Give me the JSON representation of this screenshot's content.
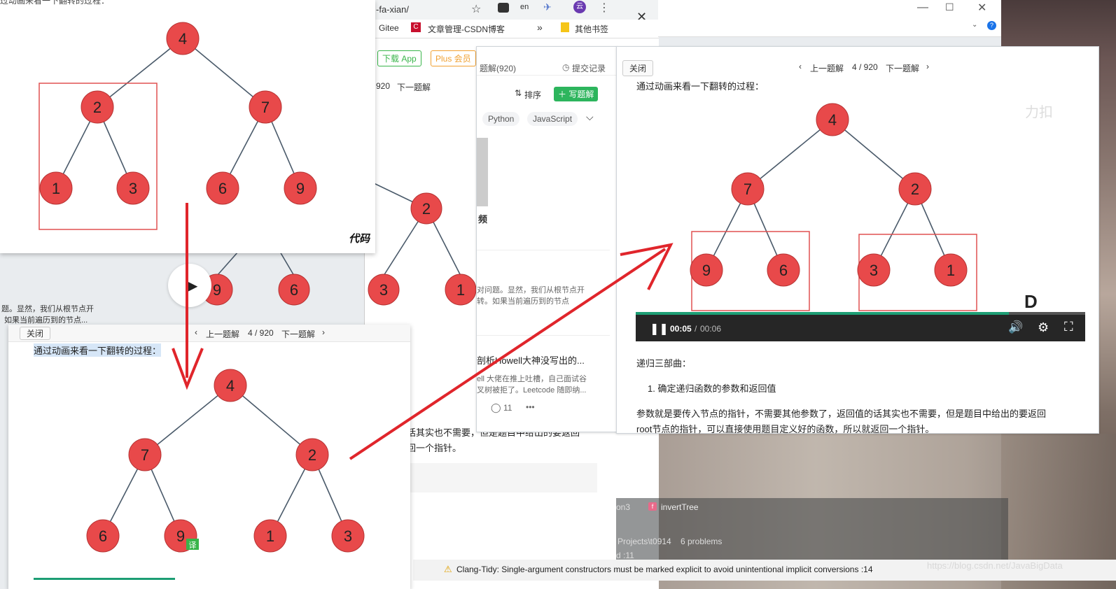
{
  "browser": {
    "url_fragment": "-fa-xian/",
    "bookmarks": [
      "Gitee",
      "文章管理-CSDN博客",
      "其他书签"
    ],
    "download_app": "下载 App",
    "plus_member": "Plus 会员",
    "page_fragment": "920",
    "next_solution": "下一题解",
    "bg_text_1": "题。显然，我们从根节点开",
    "bg_text_2": "如果当前遍历到的节点...",
    "bg_text_3": "话其实也不需要，但是题目中给出的要返回",
    "bg_text_4": "回一个指针。"
  },
  "list_panel": {
    "tab_solutions": "题解(920)",
    "tab_submissions": "提交记录",
    "sort": "排序",
    "write_solution": "写题解",
    "lang_tags": [
      "Python",
      "JavaScript"
    ],
    "video_label": "频",
    "item_text_1": "对问题。显然，我们从根节点开",
    "item_text_2": "转。如果当前遍历到的节点",
    "item_title": "剖析Howell大神没写出的...",
    "item_desc_1": "ell 大佬在推上吐槽，自己面试谷",
    "item_desc_2": "叉树被拒了。Leetcode 随即纳...",
    "comments": "11",
    "more": "•••"
  },
  "main_panel": {
    "close": "关闭",
    "prev": "上一题解",
    "page": "4 / 920",
    "next": "下一题解",
    "caption": "通过动画来看一下翻转的过程：",
    "watermark": "力扣",
    "time_current": "00:05",
    "time_total": "00:06",
    "progress": 0.83,
    "section_title": "递归三部曲：",
    "step_1": "1. 确定递归函数的参数和返回值",
    "para_1": "参数就是要传入节点的指针，不需要其他参数了，返回值的话其实也不需要，但是题目中给出的要返回",
    "para_2": "root节点的指针，可以直接使用题目定义好的函数，所以就返回一个指针。",
    "tree": {
      "root": "4",
      "left": "7",
      "right": "2",
      "ll": "9",
      "lr": "6",
      "rl": "3",
      "rr": "1"
    }
  },
  "snapshot_1": {
    "caption": "过动画来看一下翻转的过程：",
    "watermark": "代码",
    "tree": {
      "root": "4",
      "left": "2",
      "right": "7",
      "ll": "1",
      "lr": "3",
      "rl": "6",
      "rr": "9"
    }
  },
  "background_tree": {
    "right": "2",
    "ll": "9",
    "lr": "6",
    "rl": "3",
    "rr": "1"
  },
  "snapshot_2": {
    "close": "关闭",
    "prev": "上一题解",
    "page": "4 / 920",
    "next": "下一题解",
    "caption": "通过动画来看一下翻转的过程：",
    "badge": "译",
    "tree": {
      "root": "4",
      "left": "7",
      "right": "2",
      "ll": "6",
      "lr": "9",
      "rl": "1",
      "rr": "3"
    }
  },
  "ide": {
    "breadcrumb_1": "on3",
    "breadcrumb_2": "invertTree",
    "project": "Projects\\t0914",
    "problems": "6 problems",
    "line_ref": "d :11",
    "warning": "Clang-Tidy: Single-argument constructors must be marked explicit to avoid unintentional implicit conversions :14",
    "watermark_url": "https://blog.csdn.net/JavaBigData"
  },
  "colors": {
    "node_fill": "#e8494a",
    "node_stroke": "#b53333",
    "edge": "#4a5a6a",
    "box": "#e05050",
    "arrow": "#e0252b",
    "accent_green": "#2db55d"
  }
}
